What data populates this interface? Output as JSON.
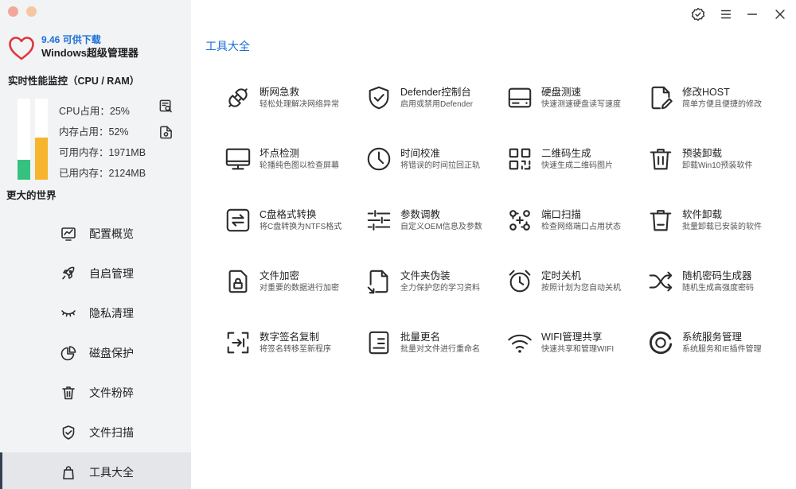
{
  "window": {
    "traffic_lights": {
      "first": "#f3a79c",
      "second": "#f6c6a2"
    },
    "controls": {
      "verify_icon": "badge-check-icon",
      "menu_icon": "menu-icon",
      "minimize_icon": "minimize-icon",
      "close_icon": "close-icon"
    }
  },
  "app": {
    "logo_icon": "heart-icon",
    "version_label": "9.46 可供下载",
    "name": "Windows超级管理器"
  },
  "monitor": {
    "title": "实时性能监控（CPU / RAM）",
    "cpu_bar": {
      "percent": 25,
      "color": "#35c27f"
    },
    "ram_bar": {
      "percent": 52,
      "color": "#f6b52d"
    },
    "stats": [
      "CPU占用：25%",
      "内存占用：52%",
      "可用内存：1971MB",
      "已用内存：2124MB"
    ],
    "side_icons": [
      "report-search-icon",
      "file-settings-icon"
    ]
  },
  "sidebar": {
    "section_title": "更大的世界",
    "items": [
      {
        "label": "配置概览",
        "icon": "chart-icon",
        "selected": false
      },
      {
        "label": "自启管理",
        "icon": "rocket-icon",
        "selected": false
      },
      {
        "label": "隐私清理",
        "icon": "eye-closed-icon",
        "selected": false
      },
      {
        "label": "磁盘保护",
        "icon": "pie-chart-icon",
        "selected": false
      },
      {
        "label": "文件粉碎",
        "icon": "trash-icon",
        "selected": false
      },
      {
        "label": "文件扫描",
        "icon": "shield-check-icon",
        "selected": false
      },
      {
        "label": "工具大全",
        "icon": "bag-icon",
        "selected": true
      }
    ]
  },
  "main": {
    "title": "工具大全",
    "tools": [
      {
        "title": "断网急救",
        "desc": "轻松处理解决网络异常",
        "icon": "plug-icon"
      },
      {
        "title": "Defender控制台",
        "desc": "启用或禁用Defender",
        "icon": "shield-check-icon"
      },
      {
        "title": "硬盘测速",
        "desc": "快速测速硬盘读写速度",
        "icon": "hard-drive-icon"
      },
      {
        "title": "修改HOST",
        "desc": "简单方便且便捷的修改",
        "icon": "file-edit-icon"
      },
      {
        "title": "坏点检测",
        "desc": "轮播纯色图以检查屏幕",
        "icon": "monitor-icon"
      },
      {
        "title": "时间校准",
        "desc": "将错误的时间拉回正轨",
        "icon": "clock-icon"
      },
      {
        "title": "二维码生成",
        "desc": "快速生成二维码图片",
        "icon": "qr-code-icon"
      },
      {
        "title": "预装卸载",
        "desc": "卸载Win10预装软件",
        "icon": "trash-icon"
      },
      {
        "title": "C盘格式转换",
        "desc": "将C盘转换为NTFS格式",
        "icon": "exchange-icon"
      },
      {
        "title": "参数调教",
        "desc": "自定义OEM信息及参数",
        "icon": "sliders-icon"
      },
      {
        "title": "端口扫描",
        "desc": "检查网络端口占用状态",
        "icon": "port-scan-icon"
      },
      {
        "title": "软件卸载",
        "desc": "批量卸载已安装的软件",
        "icon": "trash-minus-icon"
      },
      {
        "title": "文件加密",
        "desc": "对重要的数据进行加密",
        "icon": "file-lock-icon"
      },
      {
        "title": "文件夹伪装",
        "desc": "全力保护您的学习资料",
        "icon": "file-disguise-icon"
      },
      {
        "title": "定时关机",
        "desc": "按照计划为您自动关机",
        "icon": "alarm-clock-icon"
      },
      {
        "title": "随机密码生成器",
        "desc": "随机生成高强度密码",
        "icon": "shuffle-icon"
      },
      {
        "title": "数字签名复制",
        "desc": "将签名转移至新程序",
        "icon": "signature-transfer-icon"
      },
      {
        "title": "批量更名",
        "desc": "批量对文件进行重命名",
        "icon": "document-lines-icon"
      },
      {
        "title": "WIFI管理共享",
        "desc": "快速共享和管理WIFI",
        "icon": "wifi-icon"
      },
      {
        "title": "系统服务管理",
        "desc": "系统服务和IE插件管理",
        "icon": "service-ring-icon"
      }
    ]
  },
  "colors": {
    "accent": "#1a6fd6",
    "sidebar_bg": "#f2f3f5",
    "selected_bg": "#e4e6e9",
    "logo_red": "#e0363c"
  }
}
